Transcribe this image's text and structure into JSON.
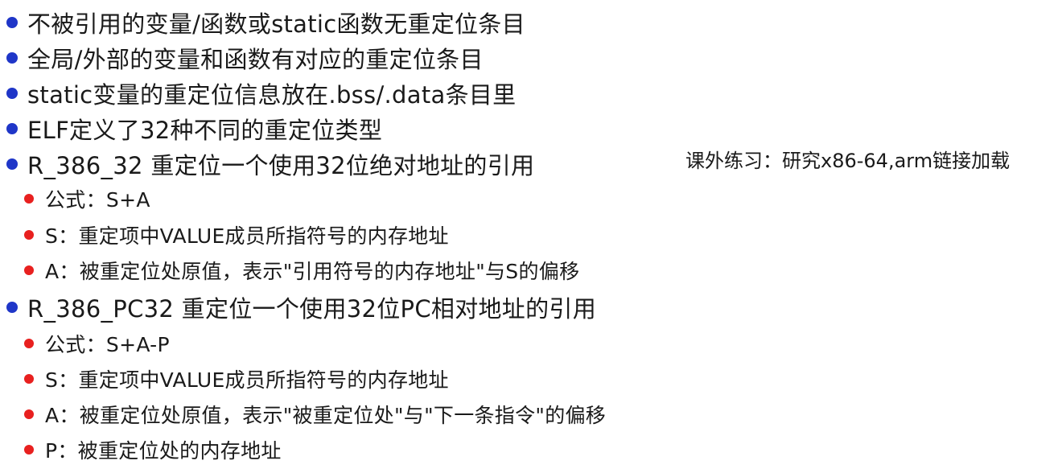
{
  "colors": {
    "primary_bullet": "#1f36c8",
    "secondary_bullet": "#e8201f",
    "text": "#1a1a1a"
  },
  "items": [
    {
      "level": 1,
      "text": "不被引用的变量/函数或static函数无重定位条目"
    },
    {
      "level": 1,
      "text": "全局/外部的变量和函数有对应的重定位条目"
    },
    {
      "level": 1,
      "text": "static变量的重定位信息放在.bss/.data条目里"
    },
    {
      "level": 1,
      "text": "ELF定义了32种不同的重定位类型"
    },
    {
      "level": 1,
      "text": "R_386_32 重定位一个使用32位绝对地址的引用"
    },
    {
      "level": 2,
      "text": "公式：S+A"
    },
    {
      "level": 2,
      "text": "S：重定项中VALUE成员所指符号的内存地址"
    },
    {
      "level": 2,
      "text": "A：被重定位处原值，表示\"引用符号的内存地址\"与S的偏移"
    },
    {
      "level": 1,
      "text": "R_386_PC32 重定位一个使用32位PC相对地址的引用"
    },
    {
      "level": 2,
      "text": "公式：S+A-P"
    },
    {
      "level": 2,
      "text": "S：重定项中VALUE成员所指符号的内存地址"
    },
    {
      "level": 2,
      "text": "A：被重定位处原值，表示\"被重定位处\"与\"下一条指令\"的偏移"
    },
    {
      "level": 2,
      "text": "P：被重定位处的内存地址"
    }
  ],
  "side_note": "课外练习：研究x86-64,arm链接加载"
}
